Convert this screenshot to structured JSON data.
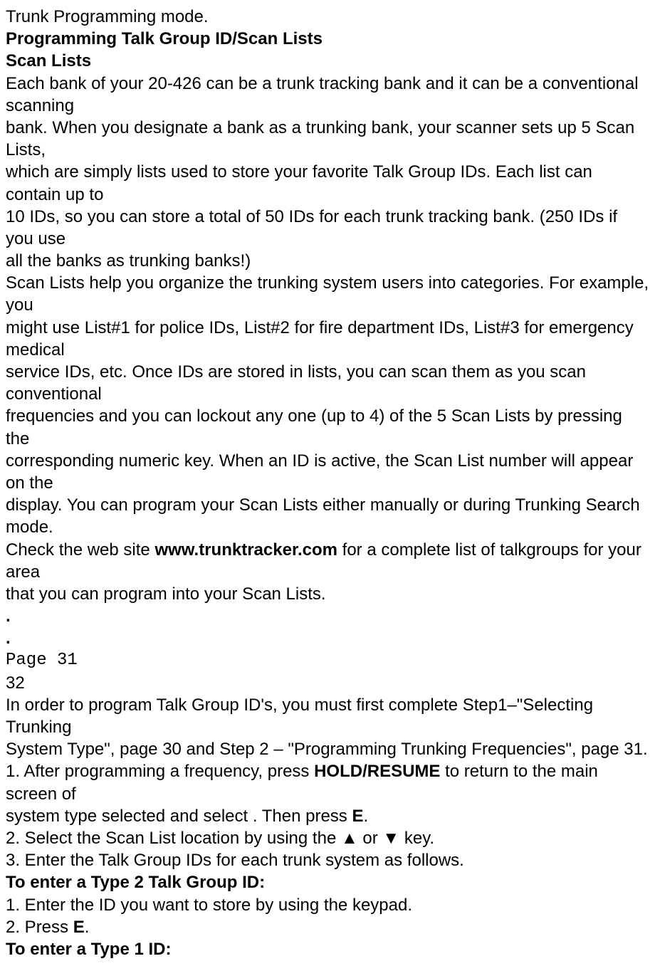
{
  "lines": {
    "l1": "Trunk Programming mode.",
    "l2": "Programming Talk Group ID/Scan Lists",
    "l3": "Scan Lists",
    "l4": "Each bank of your 20-426 can be a trunk tracking bank and it can be a conventional scanning",
    "l5": "bank. When you designate a bank as a trunking bank, your scanner sets up 5 Scan Lists,",
    "l6": "which are simply lists used to store your favorite Talk Group IDs. Each list can contain up to",
    "l7": "10 IDs, so you can store a total of 50 IDs for each trunk tracking bank. (250 IDs if you use",
    "l8": "all the banks as trunking banks!)",
    "l9": "Scan Lists help you organize the trunking system users into categories. For example, you",
    "l10": "might use List#1 for police IDs, List#2 for fire department IDs, List#3 for emergency medical",
    "l11": "service IDs, etc. Once IDs are stored in lists, you can scan them as you scan conventional",
    "l12": "frequencies and you can lockout any one (up to 4) of the 5 Scan Lists by pressing the",
    "l13": "corresponding numeric key. When an ID is active, the Scan List number will appear on the",
    "l14": "display. You can program your Scan Lists either manually or during Trunking Search mode.",
    "l15a": "Check the web site ",
    "l15b": "www.trunktracker.com",
    "l15c": " for a complete list of talkgroups for your area",
    "l16": "that you can program into your Scan Lists.",
    "dot1": ".",
    "dot2": ".",
    "page": "Page 31",
    "pnum": "32",
    "l17": "In order to program Talk Group ID's, you must first complete Step1–\"Selecting Trunking",
    "l18": "System Type\", page 30 and Step 2 – \"Programming Trunking Frequencies\", page 31.",
    "l19a": "1. After programming a frequency, press ",
    "l19b": "HOLD/RESUME",
    "l19c": " to return to the main screen of",
    "l20a": "system type selected and select . Then press ",
    "l20b": "E",
    "l20c": ".",
    "l21a": "2. Select the Scan List location by using the ",
    "l21up": "▲",
    "l21mid": " or ",
    "l21dn": "▼",
    "l21b": " key.",
    "l22": "3. Enter the Talk Group IDs for each trunk system as follows.",
    "l23": "To enter a Type 2 Talk Group ID:",
    "l24": "1. Enter the ID you want to store by using the keypad.",
    "l25a": "2. Press ",
    "l25b": "E",
    "l25c": ".",
    "l26": "To enter a Type 1 ID:"
  }
}
